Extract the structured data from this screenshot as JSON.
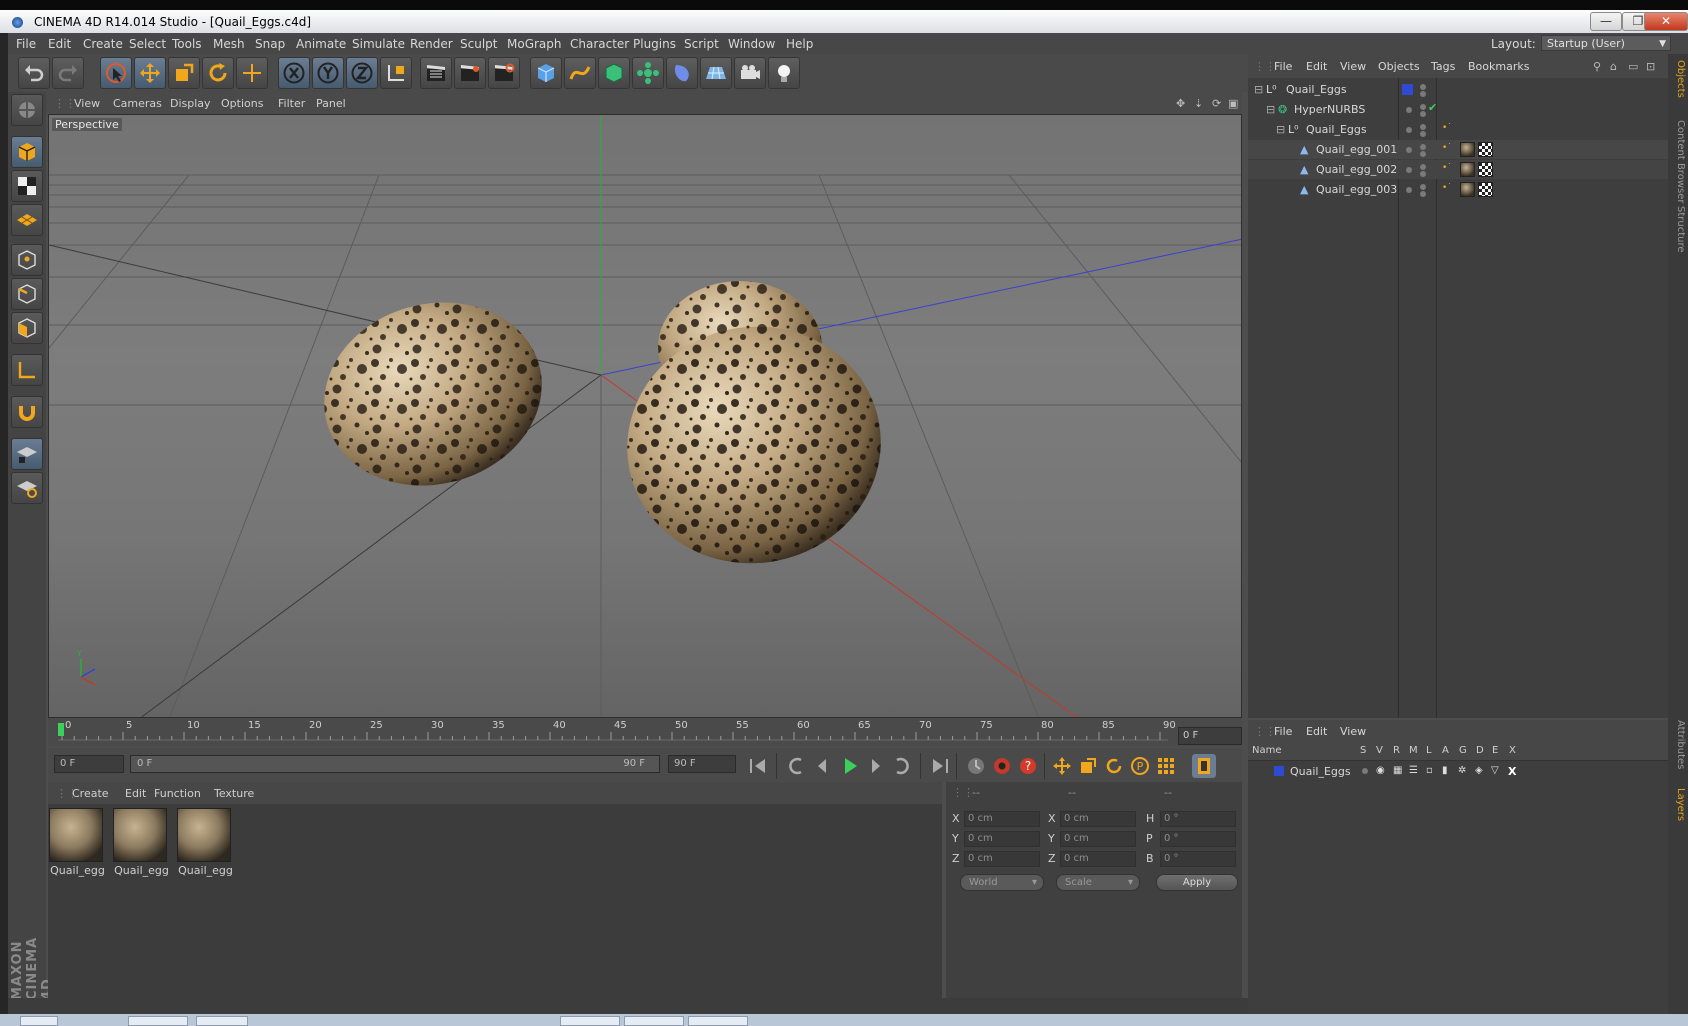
{
  "window": {
    "title": "CINEMA 4D R14.014 Studio - [Quail_Eggs.c4d]",
    "minimize_glyph": "—",
    "restore_glyph": "❐",
    "close_glyph": "✕"
  },
  "menubar": {
    "items": [
      "File",
      "Edit",
      "Create",
      "Select",
      "Tools",
      "Mesh",
      "Snap",
      "Animate",
      "Simulate",
      "Render",
      "Sculpt",
      "MoGraph",
      "Character",
      "Plugins",
      "Script",
      "Window",
      "Help"
    ],
    "layout_label": "Layout:",
    "layout_value": "Startup (User)"
  },
  "toolbar": {
    "icons": [
      "undo-icon",
      "redo-icon",
      "live-selection-icon",
      "move-icon",
      "scale-icon",
      "rotate-icon",
      "last-tool-icon",
      "x-axis-lock-icon",
      "y-axis-lock-icon",
      "z-axis-lock-icon",
      "coordinate-system-icon",
      "render-view-icon",
      "render-picture-viewer-icon",
      "edit-render-settings-icon",
      "cube-primitive-icon",
      "spline-pen-icon",
      "nurbs-icon",
      "array-icon",
      "deformer-icon",
      "floor-icon",
      "camera-icon",
      "light-icon"
    ]
  },
  "viewport": {
    "menu": [
      "View",
      "Cameras",
      "Display",
      "Options",
      "Filter",
      "Panel"
    ],
    "label": "Perspective",
    "axis_labels": [
      "Y",
      "X",
      "Z"
    ]
  },
  "timeline": {
    "ticks": [
      "0",
      "5",
      "10",
      "15",
      "20",
      "25",
      "30",
      "35",
      "40",
      "45",
      "50",
      "55",
      "60",
      "65",
      "70",
      "75",
      "80",
      "85",
      "90"
    ],
    "current_frame": "0 F",
    "start_field": "0 F",
    "range_start": "0 F",
    "range_end": "90 F",
    "end_field": "90 F"
  },
  "materials": {
    "menu": [
      "Create",
      "Edit",
      "Function",
      "Texture"
    ],
    "items": [
      "Quail_egg",
      "Quail_egg",
      "Quail_egg"
    ]
  },
  "coords": {
    "headers": [
      "--",
      "--",
      "--"
    ],
    "pos": [
      {
        "axis": "X",
        "value": "0 cm"
      },
      {
        "axis": "Y",
        "value": "0 cm"
      },
      {
        "axis": "Z",
        "value": "0 cm"
      }
    ],
    "size": [
      {
        "axis": "X",
        "value": "0 cm"
      },
      {
        "axis": "Y",
        "value": "0 cm"
      },
      {
        "axis": "Z",
        "value": "0 cm"
      }
    ],
    "rot": [
      {
        "axis": "H",
        "value": "0 °"
      },
      {
        "axis": "P",
        "value": "0 °"
      },
      {
        "axis": "B",
        "value": "0 °"
      }
    ],
    "mode_world": "World",
    "mode_scale": "Scale",
    "apply": "Apply"
  },
  "objects": {
    "menu": [
      "File",
      "Edit",
      "View",
      "Objects",
      "Tags",
      "Bookmarks"
    ],
    "rows": [
      {
        "name": "Quail_Eggs",
        "icon": "null-object-icon"
      },
      {
        "name": "HyperNURBS",
        "icon": "hypernurbs-icon"
      },
      {
        "name": "Quail_Eggs",
        "icon": "null-object-icon"
      },
      {
        "name": "Quail_egg_001",
        "icon": "polygon-object-icon"
      },
      {
        "name": "Quail_egg_002",
        "icon": "polygon-object-icon"
      },
      {
        "name": "Quail_egg_003",
        "icon": "polygon-object-icon"
      }
    ]
  },
  "layers": {
    "menu": [
      "File",
      "Edit",
      "View"
    ],
    "columns": [
      "Name",
      "S",
      "V",
      "R",
      "M",
      "L",
      "A",
      "G",
      "D",
      "E",
      "X"
    ],
    "rows": [
      {
        "name": "Quail_Eggs",
        "color": "#2f4bd6"
      }
    ]
  },
  "side_tabs": [
    "Objects",
    "Content Browser",
    "Structure",
    "Attributes",
    "Layers"
  ],
  "brand": "MAXON CINEMA 4D",
  "colors": {
    "accent_orange": "#e3a31c",
    "axis_x": "#c23a2a",
    "axis_y": "#2bb03a",
    "axis_z": "#3a40d0",
    "layer_blue": "#2f4bd6"
  }
}
